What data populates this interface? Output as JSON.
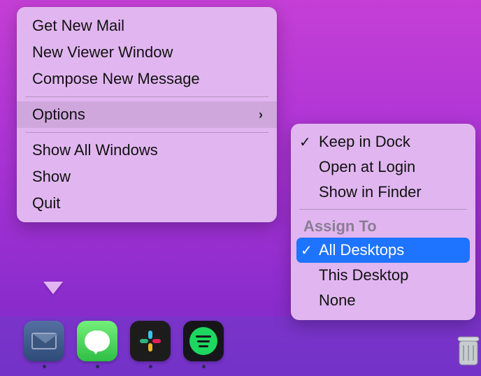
{
  "mainMenu": {
    "group1": [
      {
        "label": "Get New Mail"
      },
      {
        "label": "New Viewer Window"
      },
      {
        "label": "Compose New Message"
      }
    ],
    "options": {
      "label": "Options"
    },
    "group2": [
      {
        "label": "Show All Windows"
      },
      {
        "label": "Show"
      },
      {
        "label": "Quit"
      }
    ]
  },
  "subMenu": {
    "group1": [
      {
        "label": "Keep in Dock",
        "checked": true
      },
      {
        "label": "Open at Login",
        "checked": false
      },
      {
        "label": "Show in Finder",
        "checked": false
      }
    ],
    "assignHeader": "Assign To",
    "group2": [
      {
        "label": "All Desktops",
        "checked": true,
        "selected": true
      },
      {
        "label": "This Desktop",
        "checked": false
      },
      {
        "label": "None",
        "checked": false
      }
    ]
  },
  "dock": {
    "apps": [
      {
        "name": "Mail",
        "running": true
      },
      {
        "name": "Messages",
        "running": true
      },
      {
        "name": "Slack",
        "running": true
      },
      {
        "name": "Spotify",
        "running": true
      }
    ]
  }
}
